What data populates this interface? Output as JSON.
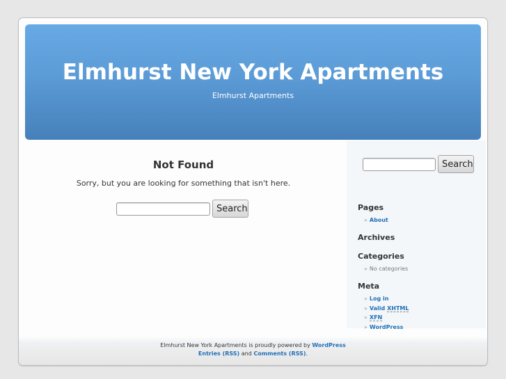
{
  "header": {
    "title": "Elmhurst New York Apartments",
    "description": "Elmhurst Apartments"
  },
  "content": {
    "heading": "Not Found",
    "message": "Sorry, but you are looking for something that isn't here.",
    "search": {
      "value": "",
      "button_label": "Search"
    }
  },
  "sidebar": {
    "search": {
      "value": "",
      "button_label": "Search"
    },
    "widgets": {
      "pages": {
        "title": "Pages",
        "items": [
          "About"
        ]
      },
      "archives": {
        "title": "Archives"
      },
      "categories": {
        "title": "Categories",
        "items": [
          "No categories"
        ]
      },
      "meta": {
        "title": "Meta",
        "login": "Log in",
        "valid_prefix": "Valid",
        "valid_abbr": "XHTML",
        "xfn": "XFN",
        "wordpress": "WordPress"
      }
    },
    "bullet": "»"
  },
  "footer": {
    "line1_text": "Elmhurst New York Apartments is proudly powered by",
    "line1_link": "WordPress",
    "entries_link": "Entries (RSS)",
    "and": "and",
    "comments_link": "Comments (RSS)",
    "period": "."
  },
  "colors": {
    "link": "#2170b8",
    "header_top": "#68aae6",
    "header_bottom": "#4680bb",
    "sidebar_bg": "#f4f7fa",
    "page_bg": "#e7e7e7"
  }
}
